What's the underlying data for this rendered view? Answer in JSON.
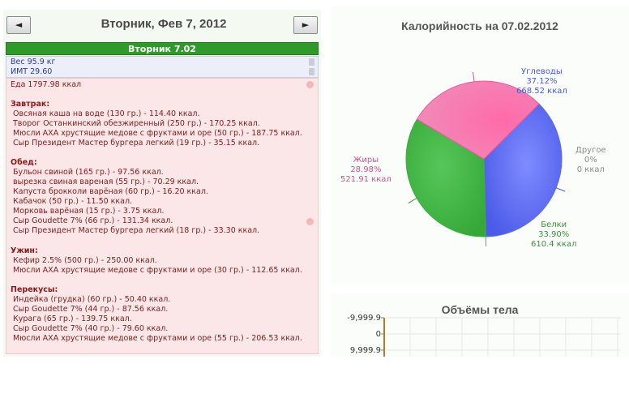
{
  "nav": {
    "prev_label": "◄",
    "next_label": "►"
  },
  "day": {
    "title": "Вторник, Фев 7, 2012",
    "bar_label": "Вторник 7.02"
  },
  "metrics": {
    "weight": "Вес 95.9 кг",
    "bmi": "ИМТ 29.60"
  },
  "food_total": "Еда 1797.98 ккал",
  "meals": [
    {
      "name": "Завтрак:",
      "items": [
        "Овсяная каша на воде (130 гр.) - 114.40 ккал.",
        "Творог Останкинский обезжиренный (250 гр.) - 170.25 ккал.",
        "Мюсли АХА хрустящие медове с фруктами и оре (50 гр.) - 187.75 ккал.",
        "Сыр Президент Мастер бургера легкий (19 гр.) - 35.15 ккал."
      ]
    },
    {
      "name": "Обед:",
      "items": [
        "Бульон свиной (165 гр.) - 97.56 ккал.",
        "вырезка свиная вареная (55 гр.) - 70.29 ккал.",
        "Капуста брокколи варёная (60 гр.) - 16.20 ккал.",
        "Кабачок (50 гр.) - 11.50 ккал.",
        "Морковь варёная (15 гр.) - 3.75 ккал.",
        "Сыр Goudette 7% (66 гр.) - 131.34 ккал.",
        "Сыр Президент Мастер бургера легкий (18 гр.) - 33.30 ккал."
      ]
    },
    {
      "name": "Ужин:",
      "items": [
        "Кефир 2.5% (500 гр.) - 250.00 ккал.",
        "Мюсли АХА хрустящие медове с фруктами и оре (30 гр.) - 112.65 ккал."
      ]
    },
    {
      "name": "Перекусы:",
      "items": [
        "Индейка (грудка) (60 гр.) - 50.40 ккал.",
        "Сыр Goudette 7% (44 гр.) - 87.56 ккал.",
        "Курага (65 гр.) - 139.75 ккал.",
        "Сыр Goudette 7% (40 гр.) - 79.60 ккал.",
        "Мюсли АХА хрустящие медове с фруктами и оре (55 гр.) - 206.53 ккал."
      ]
    }
  ],
  "chart_data": {
    "type": "pie",
    "title": "Калорийность на 07.02.2012",
    "slices": [
      {
        "name": "Углеводы",
        "percent": "37.12%",
        "kcal": "668.52 ккал",
        "value": 37.12,
        "color": "#5a6cf0",
        "label_color": "#4a5bd0"
      },
      {
        "name": "Другое",
        "percent": "0%",
        "kcal": "0 ккал",
        "value": 0,
        "color": "#999999",
        "label_color": "#8a8a8a"
      },
      {
        "name": "Белки",
        "percent": "33.90%",
        "kcal": "610.4 ккал",
        "value": 33.9,
        "color": "#3cb040",
        "label_color": "#2f9a2f"
      },
      {
        "name": "Жиры",
        "percent": "28.98%",
        "kcal": "521.91 ккал",
        "value": 28.98,
        "color": "#f05a9a",
        "label_color": "#e04a8a"
      }
    ]
  },
  "volumes": {
    "title": "Объёмы тела",
    "y_ticks": [
      "-9,999.9",
      "0",
      "9,999.9"
    ]
  }
}
